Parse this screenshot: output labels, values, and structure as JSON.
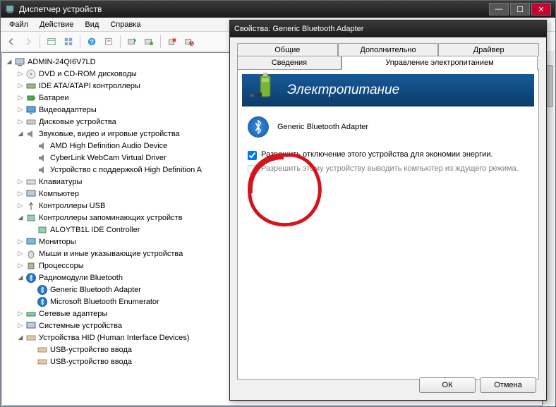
{
  "window": {
    "title": "Диспетчер устройств"
  },
  "menu": {
    "file": "Файл",
    "action": "Действие",
    "view": "Вид",
    "help": "Справка"
  },
  "tree": {
    "root": "ADMIN-24QI6V7LD",
    "dvd": "DVD и CD-ROM дисководы",
    "ide": "IDE ATA/ATAPI контроллеры",
    "bat": "Батареи",
    "vid": "Видеоадаптеры",
    "disk": "Дисковые устройства",
    "snd": "Звуковые, видео и игровые устройства",
    "snd1": "AMD High Definition Audio Device",
    "snd2": "CyberLink WebCam Virtual Driver",
    "snd3": "Устройство с поддержкой High Definition A",
    "kb": "Клавиатуры",
    "comp": "Компьютер",
    "usb": "Контроллеры USB",
    "stor": "Контроллеры запоминающих устройств",
    "stor1": "ALOYTB1L IDE Controller",
    "mon": "Мониторы",
    "mouse": "Мыши и иные указывающие устройства",
    "cpu": "Процессоры",
    "bt": "Радиомодули Bluetooth",
    "bt1": "Generic Bluetooth Adapter",
    "bt2": "Microsoft Bluetooth Enumerator",
    "net": "Сетевые адаптеры",
    "sys": "Системные устройства",
    "hid": "Устройства HID (Human Interface Devices)",
    "hid1": "USB-устройство ввода",
    "hid2": "USB-устройство ввода"
  },
  "dialog": {
    "title": "Свойства: Generic Bluetooth Adapter",
    "tabs": {
      "general": "Общие",
      "advanced": "Дополнительно",
      "driver": "Драйвер",
      "details": "Сведения",
      "power": "Управление электропитанием"
    },
    "banner": "Электропитание",
    "device": "Generic Bluetooth Adapter",
    "opt1": "Разрешить отключение этого устройства для экономии энергии.",
    "opt2": "Разрешить этому устройству выводить компьютер из ждущего режима.",
    "ok": "ОК",
    "cancel": "Отмена"
  }
}
